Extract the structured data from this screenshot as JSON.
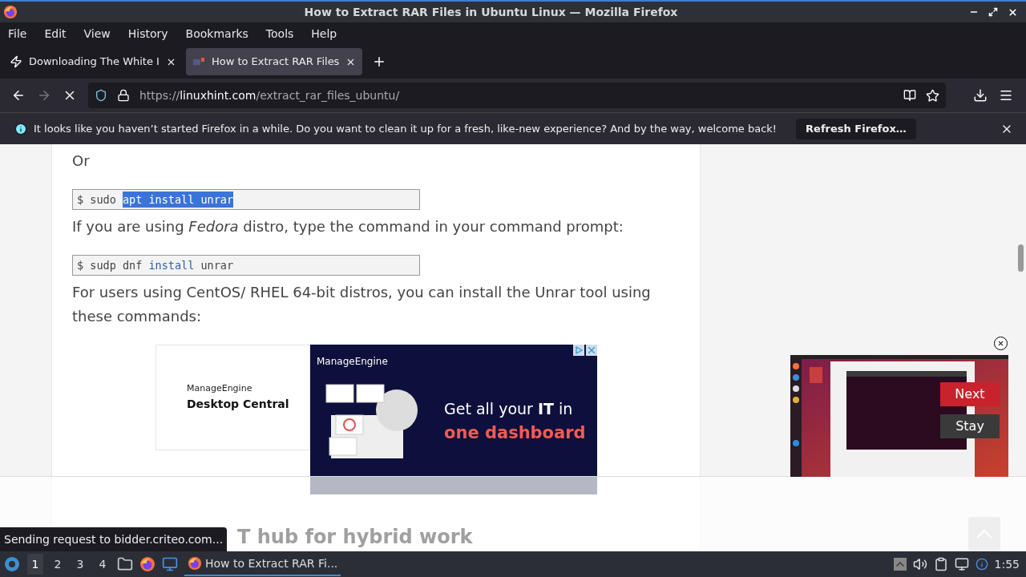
{
  "window": {
    "title": "How to Extract RAR Files in Ubuntu Linux — Mozilla Firefox"
  },
  "menu": [
    "File",
    "Edit",
    "View",
    "History",
    "Bookmarks",
    "Tools",
    "Help"
  ],
  "tabs": [
    {
      "label": "Downloading The White I",
      "selected": false
    },
    {
      "label": "How to Extract RAR Files",
      "selected": true
    }
  ],
  "address": {
    "prefix": "https://",
    "domain": "linuxhint.com",
    "path": "/extract_rar_files_ubuntu/"
  },
  "notification": {
    "message": "It looks like you haven’t started Firefox in a while. Do you want to clean it up for a fresh, like-new experience? And by the way, welcome back!",
    "button": "Refresh Firefox…"
  },
  "article": [
    {
      "kind": "text",
      "text": "Or"
    },
    {
      "kind": "code",
      "segments": [
        {
          "text": "$ sudo ",
          "kind": "plain",
          "selected": false
        },
        {
          "text": "apt install unrar",
          "kind": "plain",
          "selected": true
        }
      ]
    },
    {
      "kind": "text",
      "text": "If you are using *Fedora* distro, type the command in your command prompt:"
    },
    {
      "kind": "code",
      "segments": [
        {
          "text": "$ sudp dnf ",
          "kind": "plain",
          "selected": false
        },
        {
          "text": "install",
          "kind": "keyword",
          "selected": false
        },
        {
          "text": " unrar",
          "kind": "plain",
          "selected": false
        }
      ]
    },
    {
      "kind": "text",
      "text": "For users using CentOS/ RHEL 64-bit distros, you can install the Unrar tool using these commands:"
    }
  ],
  "ad": {
    "left_brand": "ManageEngine",
    "left_product": "Desktop Central",
    "brand": "ManageEngine",
    "headline": "Get all your **IT** in",
    "highlight": "one dashboard"
  },
  "faded_heading": "T hub for hybrid work",
  "video": {
    "buttons": [
      {
        "label": "Next",
        "kind": "primary"
      },
      {
        "label": "Stay",
        "kind": "secondary"
      }
    ]
  },
  "status": "Sending request to bidder.criteo.com...",
  "taskbar": {
    "workspaces": [
      {
        "label": "1",
        "selected": true
      },
      {
        "label": "2",
        "selected": false
      },
      {
        "label": "3",
        "selected": false
      },
      {
        "label": "4",
        "selected": false
      }
    ],
    "task": "How to Extract RAR Fi...",
    "clock": "1:55"
  }
}
